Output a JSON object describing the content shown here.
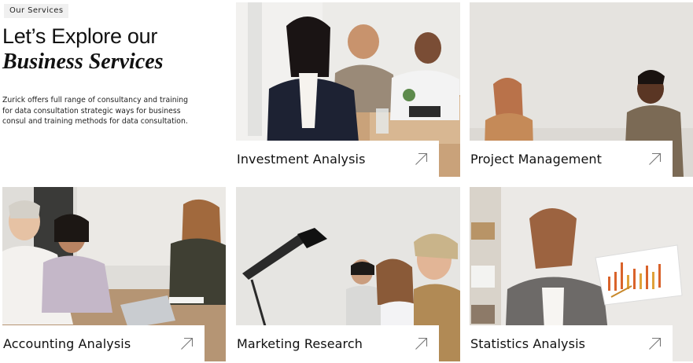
{
  "intro": {
    "tag": "Our Services",
    "title_line1": "Let’s Explore our",
    "title_line2": "Business Services",
    "description": "Zurick offers full range of consultancy and training for data consultation strategic ways for business consul and training methods for data consultation."
  },
  "services": [
    {
      "label": "Investment Analysis",
      "icon": "arrow-up-right-icon"
    },
    {
      "label": "Project Management",
      "icon": "arrow-up-right-icon"
    },
    {
      "label": "Accounting Analysis",
      "icon": "arrow-up-right-icon"
    },
    {
      "label": "Marketing Research",
      "icon": "arrow-up-right-icon"
    },
    {
      "label": "Statistics Analysis",
      "icon": "arrow-up-right-icon"
    }
  ],
  "colors": {
    "text": "#111111",
    "tag_bg": "#f0f0f0",
    "plate_bg": "#ffffff"
  }
}
